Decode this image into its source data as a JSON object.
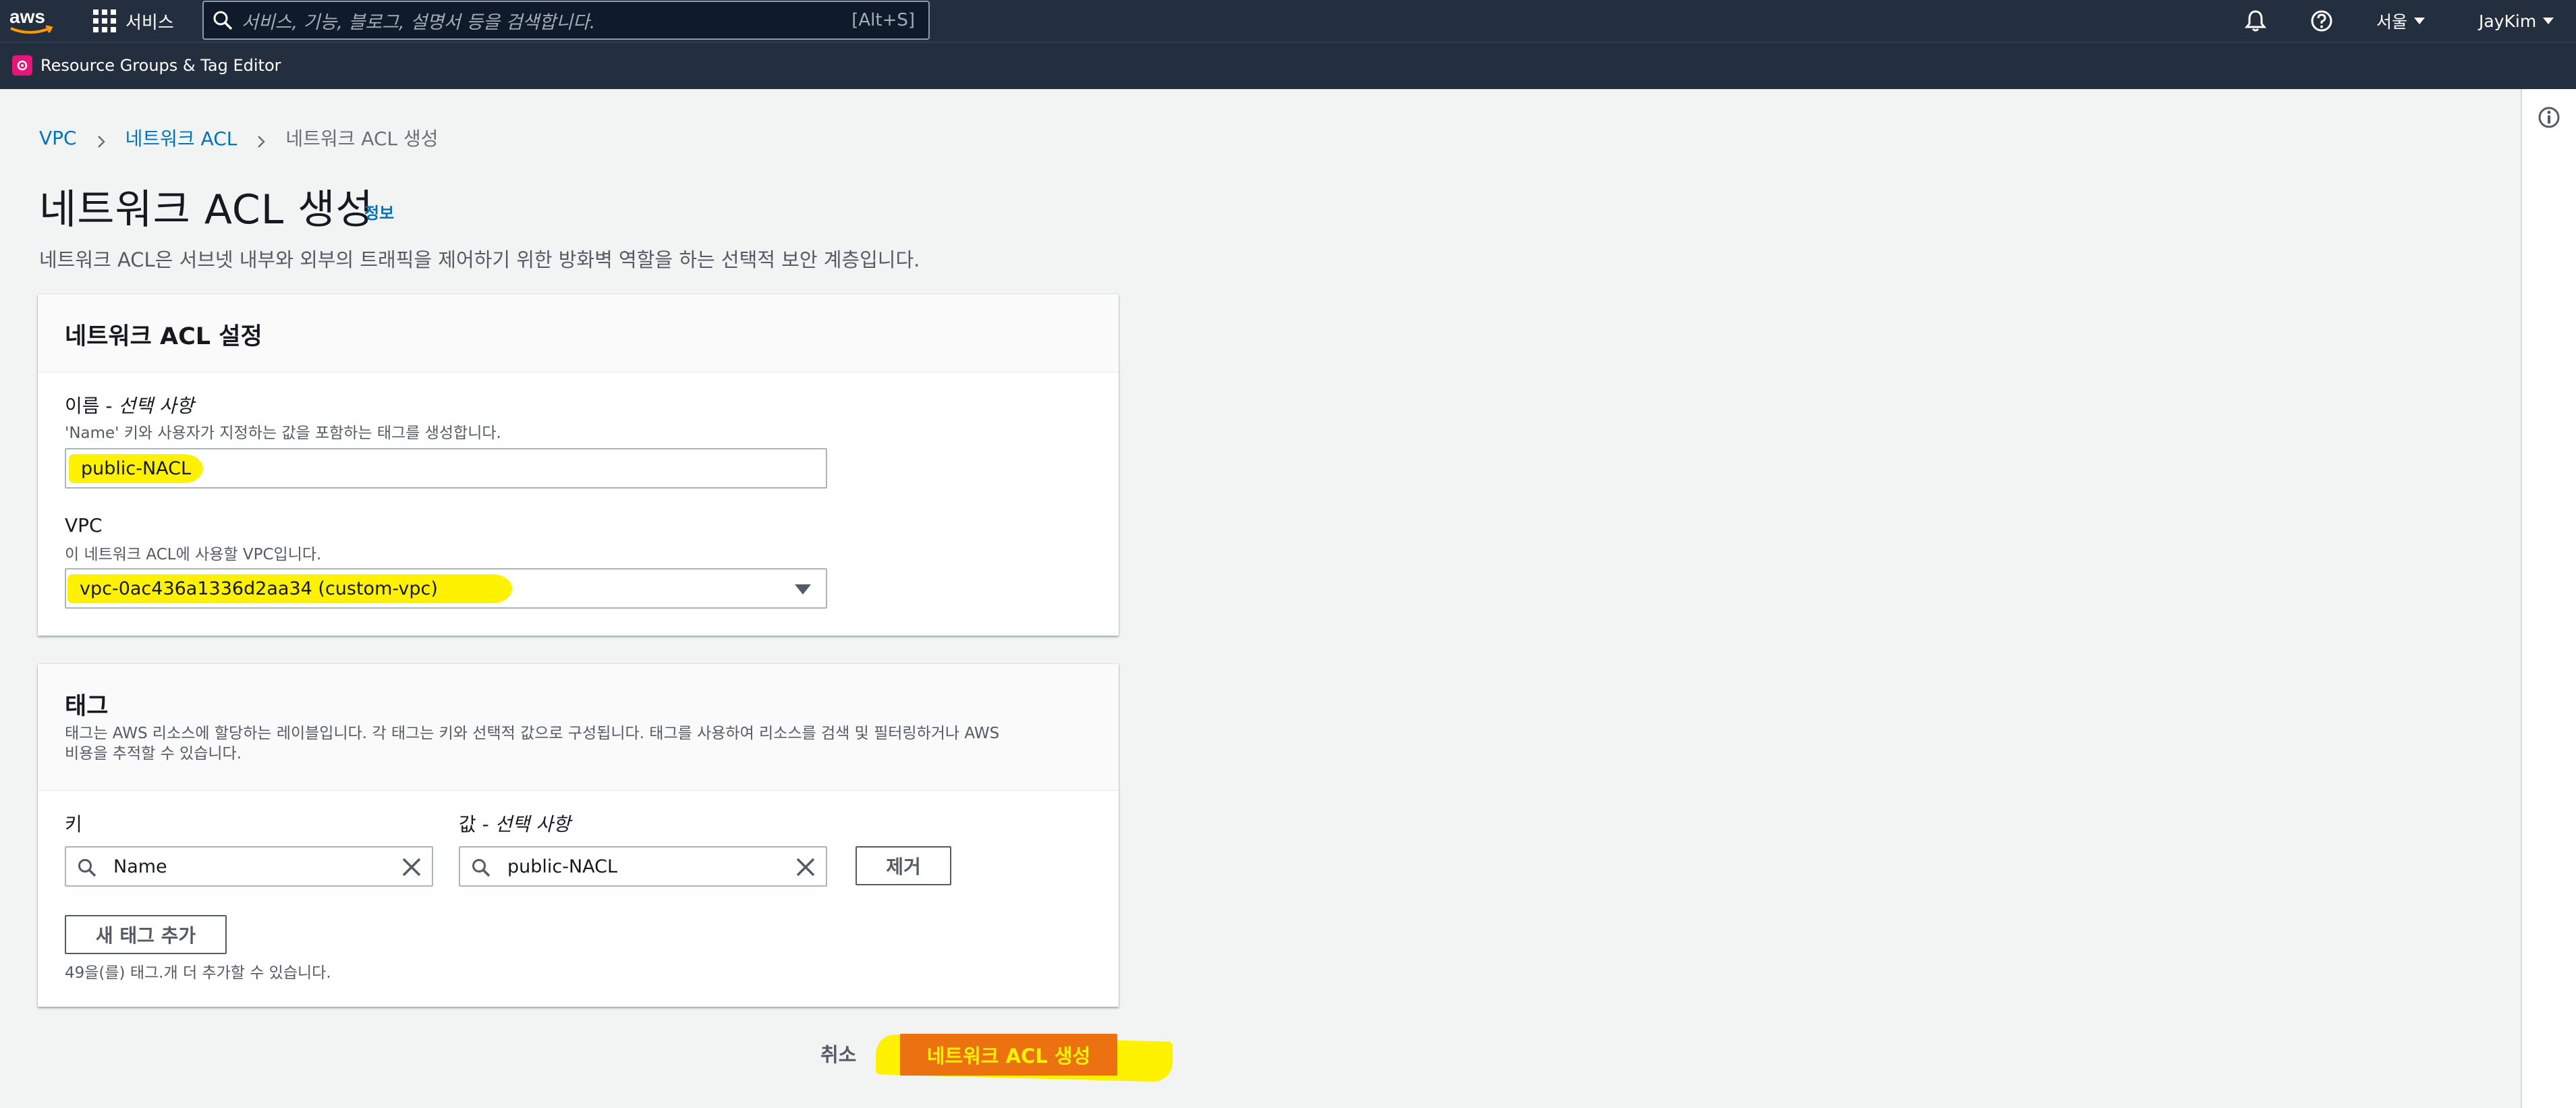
{
  "topnav": {
    "logo_text": "aws",
    "services_label": "서비스",
    "search_placeholder": "서비스, 기능, 블로그, 설명서 등을 검색합니다.",
    "search_shortcut": "[Alt+S]",
    "region_label": "서울",
    "user_label": "JayKim"
  },
  "subnav": {
    "resource_groups_label": "Resource Groups & Tag Editor"
  },
  "breadcrumb": {
    "items": [
      "VPC",
      "네트워크 ACL",
      "네트워크 ACL 생성"
    ]
  },
  "page": {
    "title": "네트워크 ACL 생성",
    "info_label": "정보",
    "description": "네트워크 ACL은 서브넷 내부와 외부의 트래픽을 제어하기 위한 방화벽 역할을 하는 선택적 보안 계층입니다."
  },
  "settings": {
    "header": "네트워크 ACL 설정",
    "name_label": "이름 - ",
    "name_optional": "선택 사항",
    "name_desc": "'Name' 키와 사용자가 지정하는 값을 포함하는 태그를 생성합니다.",
    "name_value": "public-NACL",
    "vpc_label": "VPC",
    "vpc_desc": "이 네트워크 ACL에 사용할 VPC입니다.",
    "vpc_value": "vpc-0ac436a1336d2aa34 (custom-vpc)"
  },
  "tags": {
    "header": "태그",
    "desc_line1": "태그는 AWS 리소스에 할당하는 레이블입니다. 각 태그는 키와 선택적 값으로 구성됩니다. 태그를 사용하여 리소스를 검색 및 필터링하거나 AWS",
    "desc_line2": "비용을 추적할 수 있습니다.",
    "key_label": "키",
    "value_label": "값 - ",
    "value_optional": "선택 사항",
    "rows": [
      {
        "key": "Name",
        "value": "public-NACL",
        "remove_label": "제거"
      }
    ],
    "add_tag_label": "새 태그 추가",
    "remaining_note": "49을(를) 태그.개 더 추가할 수 있습니다."
  },
  "actions": {
    "cancel_label": "취소",
    "create_label": "네트워크 ACL 생성"
  },
  "colors": {
    "nav_bg": "#232f3e",
    "link": "#0073bb",
    "primary": "#ec7211",
    "highlight": "#fff200"
  },
  "icons": [
    "aws-logo",
    "grid-icon",
    "search-icon",
    "bell-icon",
    "help-icon",
    "caret-down-icon",
    "resource-groups-icon",
    "info-icon",
    "chevron-right-icon",
    "magnifier-icon",
    "clear-x-icon"
  ]
}
